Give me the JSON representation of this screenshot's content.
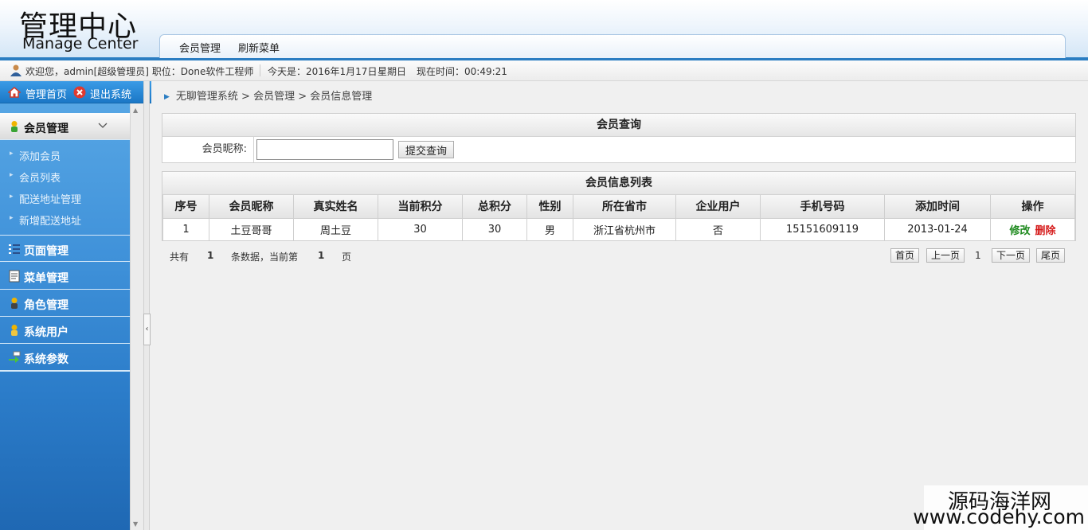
{
  "header": {
    "logo_cn": "管理中心",
    "logo_en": "Manage Center",
    "nav": [
      "会员管理",
      "刷新菜单"
    ]
  },
  "userbar": {
    "welcome": "欢迎您，admin[超级管理员] 职位：Done软件工程师",
    "today": "今天是：2016年1月17日",
    "weekday": "星期日",
    "time": "现在时间：00:49:21"
  },
  "sidebar": {
    "home": "管理首页",
    "logout": "退出系统",
    "menus": [
      {
        "label": "会员管理",
        "icon": "member-icon",
        "sub": [
          "添加会员",
          "会员列表",
          "配送地址管理",
          "新增配送地址"
        ]
      },
      {
        "label": "页面管理",
        "icon": "page-list-icon"
      },
      {
        "label": "菜单管理",
        "icon": "menu-doc-icon"
      },
      {
        "label": "角色管理",
        "icon": "role-icon"
      },
      {
        "label": "系统用户",
        "icon": "user-icon"
      },
      {
        "label": "系统参数",
        "icon": "params-icon"
      }
    ]
  },
  "breadcrumb": "无聊管理系统 > 会员管理 > 会员信息管理",
  "search": {
    "title": "会员查询",
    "label": "会员昵称:",
    "value": "",
    "button": "提交查询"
  },
  "table": {
    "title": "会员信息列表",
    "columns": [
      "序号",
      "会员昵称",
      "真实姓名",
      "当前积分",
      "总积分",
      "性别",
      "所在省市",
      "企业用户",
      "手机号码",
      "添加时间",
      "操作"
    ],
    "rows": [
      {
        "no": "1",
        "nick": "土豆哥哥",
        "name": "周土豆",
        "points": "30",
        "total": "30",
        "gender": "男",
        "city": "浙江省杭州市",
        "company": "否",
        "phone": "15151609119",
        "date": "2013-01-24",
        "edit": "修改",
        "delete": "删除"
      }
    ]
  },
  "pager": {
    "total_prefix": "共有",
    "total": "1",
    "mid": "条数据，当前第",
    "page": "1",
    "suffix": "页",
    "first": "首页",
    "prev": "上一页",
    "current": "1",
    "next": "下一页",
    "last": "尾页"
  },
  "watermark": {
    "line1": "源码海洋网",
    "line2": "www.codehy.com"
  },
  "colors": {
    "accent": "#2b7dc2",
    "sidebar": "#3f91d9",
    "edit": "#1e8a1e",
    "delete": "#d51a1a"
  }
}
